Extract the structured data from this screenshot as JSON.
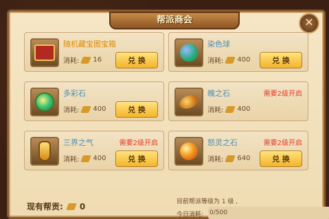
{
  "title": "帮派商会",
  "close_icon": "close-icon",
  "items": [
    {
      "name": "随机藏宝图宝箱",
      "cost_label": "消耗:",
      "cost": "16",
      "button": "兑 换",
      "special": true,
      "requirement": ""
    },
    {
      "name": "染色球",
      "cost_label": "消耗:",
      "cost": "400",
      "button": "兑 换",
      "special": false,
      "requirement": ""
    },
    {
      "name": "多彩石",
      "cost_label": "消耗:",
      "cost": "400",
      "button": "兑 换",
      "special": false,
      "requirement": ""
    },
    {
      "name": "魄之石",
      "cost_label": "消耗:",
      "cost": "400",
      "button": "",
      "special": false,
      "requirement": "需要2级开启"
    },
    {
      "name": "三界之气",
      "cost_label": "消耗:",
      "cost": "400",
      "button": "兑 换",
      "special": false,
      "requirement": "需要2级开启"
    },
    {
      "name": "怒灵之石",
      "cost_label": "消耗:",
      "cost": "640",
      "button": "兑 换",
      "special": false,
      "requirement": "需要2级开启"
    }
  ],
  "footer": {
    "contribution_label": "现有帮贡:",
    "contribution_value": "0",
    "level_text": "目前帮派等级为 1 级 ,",
    "today_label": "今日消耗:",
    "today_value": "0/500"
  }
}
